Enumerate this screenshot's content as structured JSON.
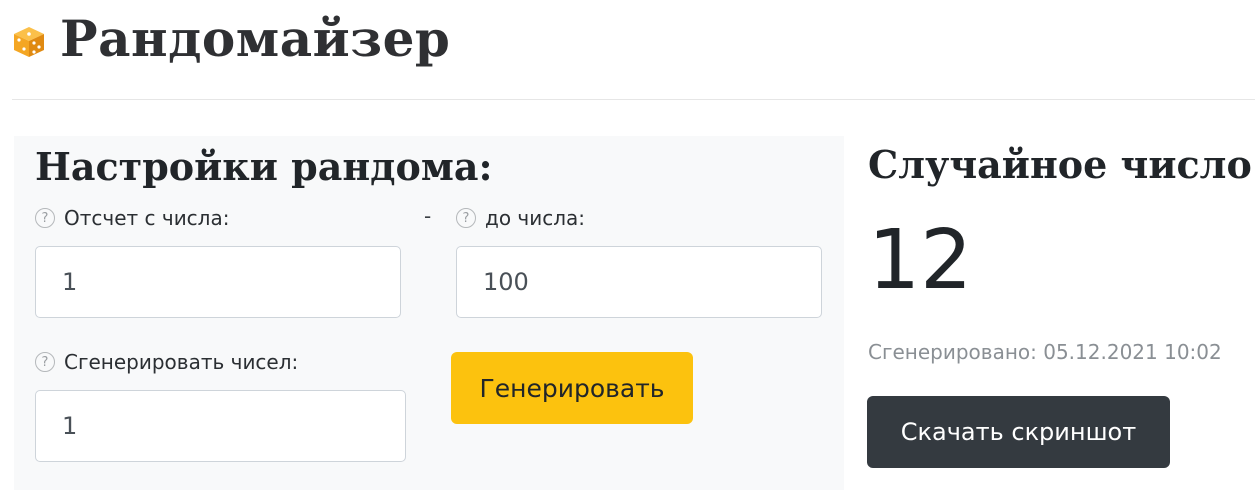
{
  "header": {
    "title": "Рандомайзер",
    "icon": "dice-icon"
  },
  "settings": {
    "title": "Настройки рандома:",
    "from": {
      "label": "Отсчет с числа:",
      "value": "1"
    },
    "separator": "-",
    "to": {
      "label": "до числа:",
      "value": "100"
    },
    "count": {
      "label": "Сгенерировать чисел:",
      "value": "1"
    },
    "generate_label": "Генерировать",
    "help_glyph": "?"
  },
  "result": {
    "title": "Случайное число:",
    "number": "12",
    "generated_at": "Сгенерировано: 05.12.2021 10:02",
    "download_label": "Скачать скриншот"
  },
  "colors": {
    "accent_yellow": "#fcc20e",
    "dark_button": "#343a40",
    "panel_bg": "#f8f9fa",
    "dice": "#f4a623"
  }
}
